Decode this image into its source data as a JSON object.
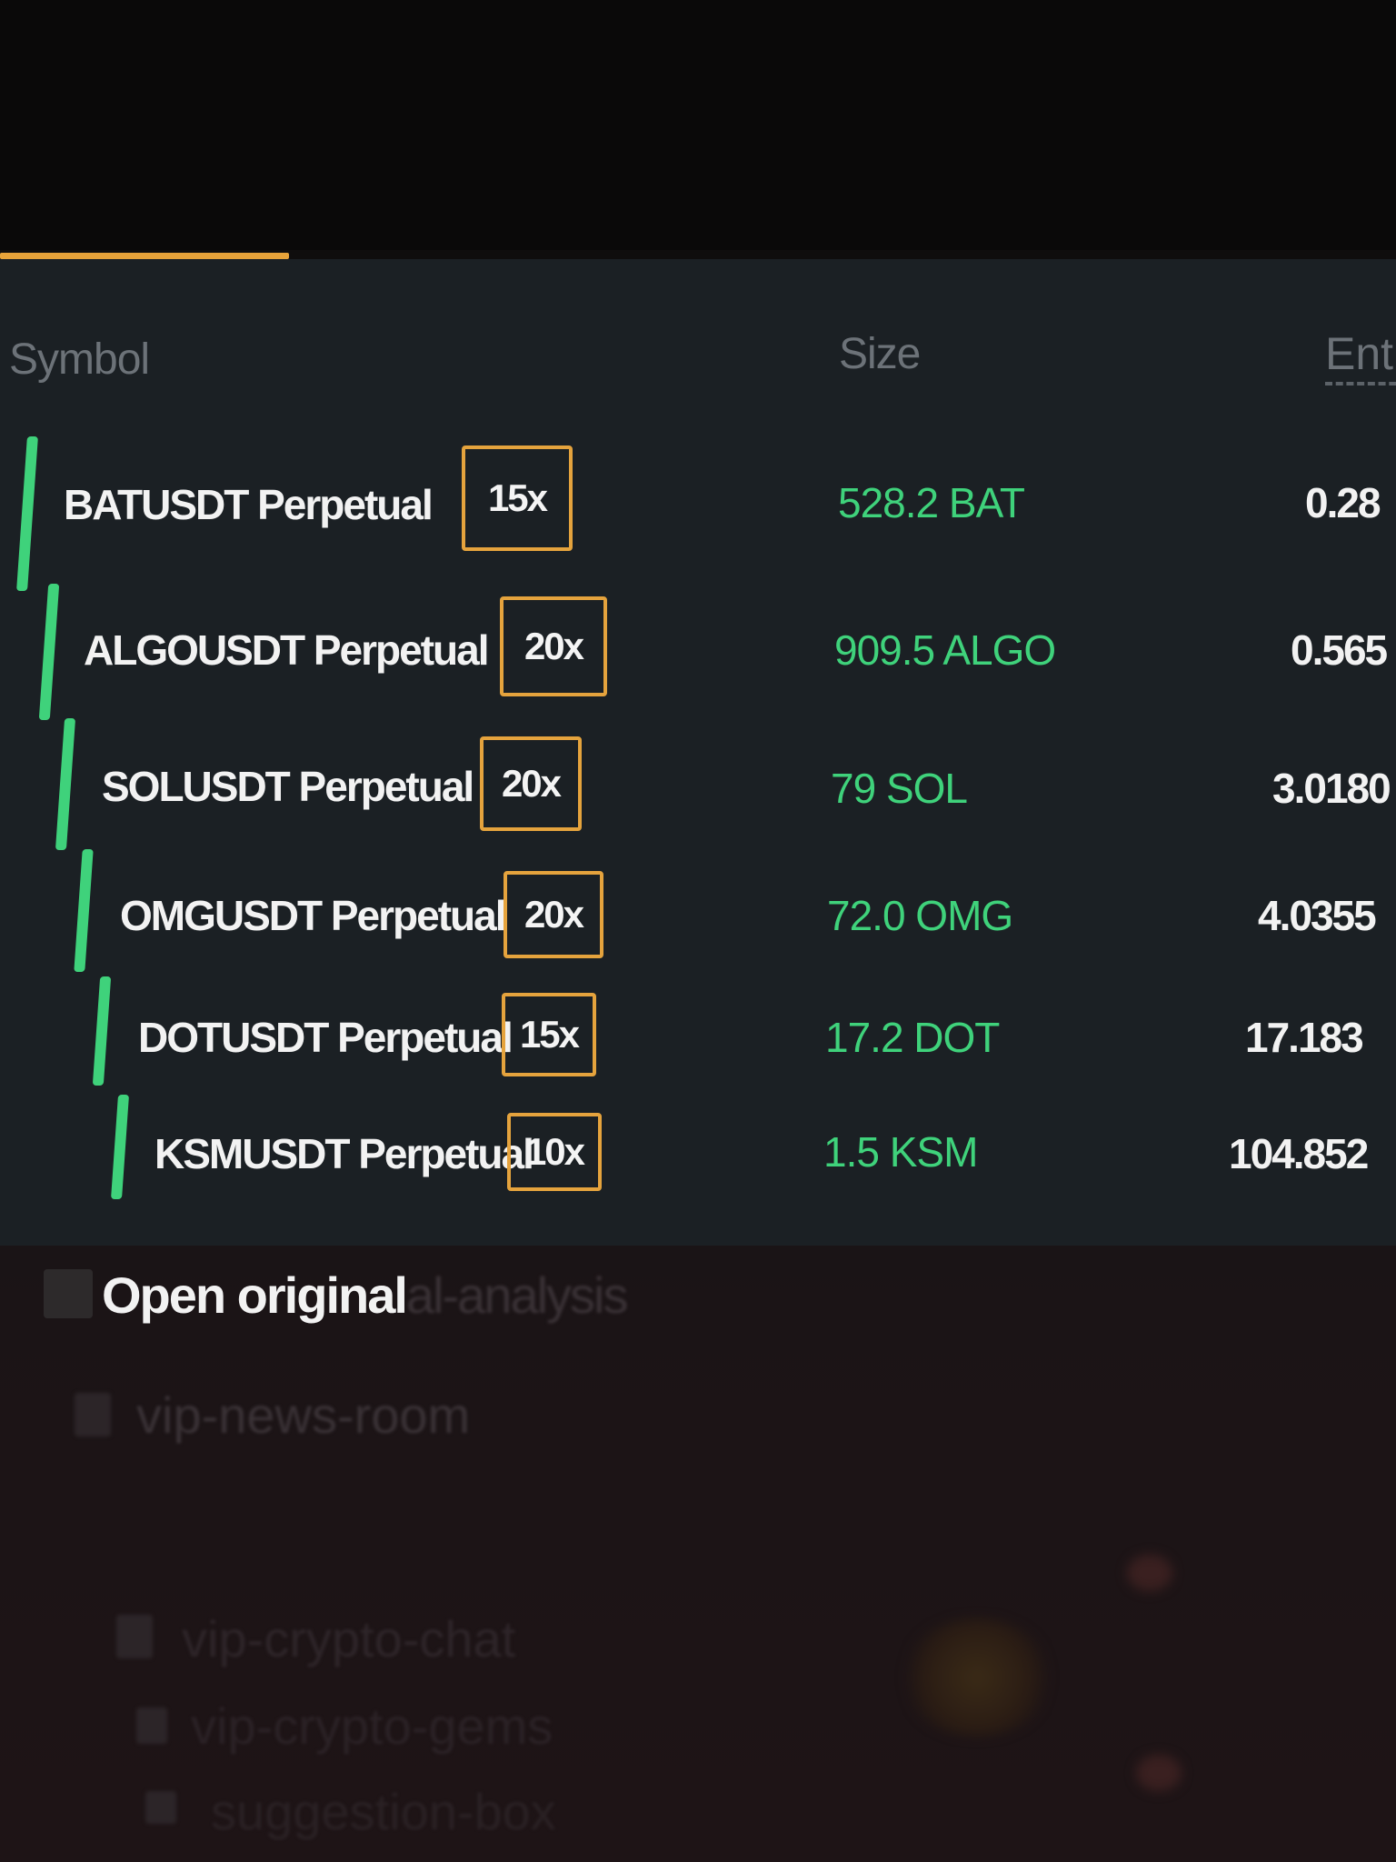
{
  "table": {
    "headers": {
      "symbol": "Symbol",
      "size": "Size",
      "entry": "Ent"
    },
    "rows": [
      {
        "symbol": "BATUSDT Perpetual",
        "leverage": "15x",
        "size": "528.2 BAT",
        "entry": "0.28"
      },
      {
        "symbol": "ALGOUSDT Perpetual",
        "leverage": "20x",
        "size": "909.5 ALGO",
        "entry": "0.565"
      },
      {
        "symbol": "SOLUSDT Perpetual",
        "leverage": "20x",
        "size": "79 SOL",
        "entry": "3.0180"
      },
      {
        "symbol": "OMGUSDT Perpetual",
        "leverage": "20x",
        "size": "72.0 OMG",
        "entry": "4.0355"
      },
      {
        "symbol": "DOTUSDT Perpetual",
        "leverage": "15x",
        "size": "17.2 DOT",
        "entry": "17.183"
      },
      {
        "symbol": "KSMUSDT Perpetual",
        "leverage": "10x",
        "size": "1.5 KSM",
        "entry": "104.852"
      }
    ]
  },
  "overlay": {
    "open_original": "Open original"
  },
  "channels": [
    "al-analysis",
    "vip-news-room",
    "vip-crypto-chat",
    "vip-crypto-gems",
    "suggestion-box"
  ],
  "colors": {
    "accent": "#e8a33a",
    "positive": "#3fd27b",
    "panel": "#1b2024"
  }
}
